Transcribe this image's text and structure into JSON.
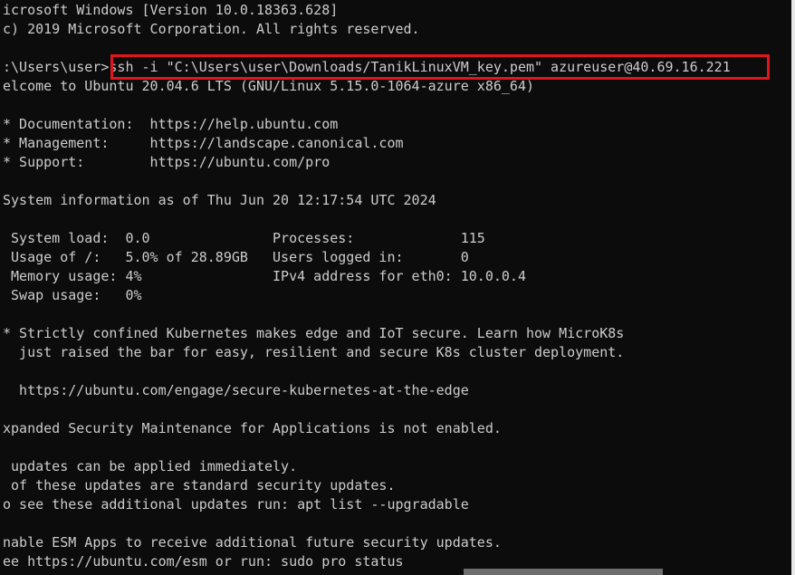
{
  "terminal": {
    "lines": [
      "icrosoft Windows [Version 10.0.18363.628]",
      "c) 2019 Microsoft Corporation. All rights reserved.",
      "",
      ":\\Users\\user>ssh -i \"C:\\Users\\user\\Downloads/TanikLinuxVM_key.pem\" azureuser@40.69.16.221",
      "elcome to Ubuntu 20.04.6 LTS (GNU/Linux 5.15.0-1064-azure x86_64)",
      "",
      "* Documentation:  https://help.ubuntu.com",
      "* Management:     https://landscape.canonical.com",
      "* Support:        https://ubuntu.com/pro",
      "",
      "System information as of Thu Jun 20 12:17:54 UTC 2024",
      "",
      " System load:  0.0               Processes:             115",
      " Usage of /:   5.0% of 28.89GB   Users logged in:       0",
      " Memory usage: 4%                IPv4 address for eth0: 10.0.0.4",
      " Swap usage:   0%",
      "",
      "* Strictly confined Kubernetes makes edge and IoT secure. Learn how MicroK8s",
      "  just raised the bar for easy, resilient and secure K8s cluster deployment.",
      "",
      "  https://ubuntu.com/engage/secure-kubernetes-at-the-edge",
      "",
      "xpanded Security Maintenance for Applications is not enabled.",
      "",
      " updates can be applied immediately.",
      " of these updates are standard security updates.",
      "o see these additional updates run: apt list --upgradable",
      "",
      "nable ESM Apps to receive additional future security updates.",
      "ee https://ubuntu.com/esm or run: sudo pro status"
    ]
  },
  "colors": {
    "background": "#0c0c0c",
    "foreground": "#cccccc",
    "highlight_border": "#e0161e"
  }
}
